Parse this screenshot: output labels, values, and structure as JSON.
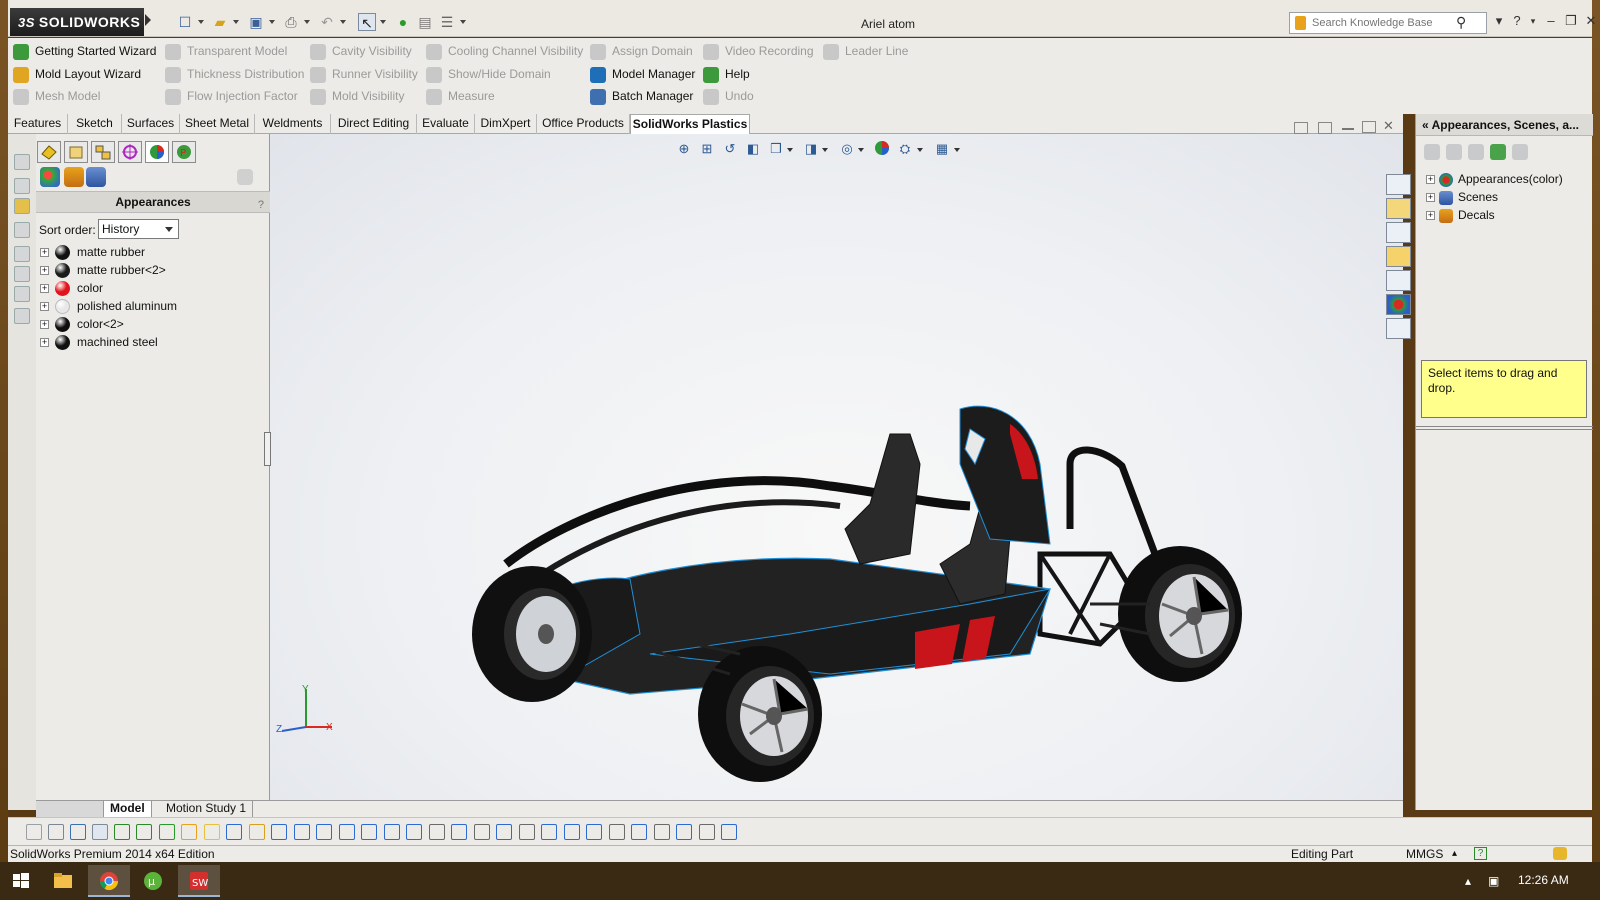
{
  "titlebar": {
    "logo_ds": "3S",
    "logo_text": "SOLIDWORKS",
    "document_title": "Ariel atom",
    "search_placeholder": "Search Knowledge Base",
    "search_icon": "magnifier-icon",
    "help_icon": "question-icon"
  },
  "command_manager": {
    "col1": [
      "Getting Started Wizard",
      "Mold Layout Wizard",
      "Mesh Model"
    ],
    "col2": [
      "Transparent Model",
      "Thickness Distribution",
      "Flow Injection Factor"
    ],
    "col3": [
      "Cavity Visibility",
      "Runner Visibility",
      "Mold Visibility"
    ],
    "col4": [
      "Cooling Channel Visibility",
      "Show/Hide Domain",
      "Measure"
    ],
    "col5": [
      "Assign Domain",
      "Model Manager",
      "Batch Manager"
    ],
    "col6": [
      "Video Recording",
      "Help",
      "Undo"
    ],
    "col7": [
      "Leader Line"
    ]
  },
  "tabs": [
    "Features",
    "Sketch",
    "Surfaces",
    "Sheet Metal",
    "Weldments",
    "Direct Editing",
    "Evaluate",
    "DimXpert",
    "Office Products",
    "SolidWorks Plastics"
  ],
  "active_tab": "SolidWorks Plastics",
  "feature_manager": {
    "header": "Appearances",
    "help": "?",
    "sort_label": "Sort order:",
    "sort_value": "History",
    "items": [
      {
        "label": "matte rubber",
        "color": "#111111"
      },
      {
        "label": "matte rubber<2>",
        "color": "#1a1a1a"
      },
      {
        "label": "color",
        "color": "#e0141b"
      },
      {
        "label": "polished aluminum",
        "color": "#e8e8e8"
      },
      {
        "label": "color<2>",
        "color": "#0d0d0d"
      },
      {
        "label": "machined steel",
        "color": "#101010"
      }
    ]
  },
  "bottom_tabs": [
    "Model",
    "Motion Study 1"
  ],
  "axes": {
    "x": "X",
    "y": "Y",
    "z": "Z"
  },
  "task_pane": {
    "title": "Appearances, Scenes, a...",
    "tree": [
      "Appearances(color)",
      "Scenes",
      "Decals"
    ],
    "hint": "Select items to drag and drop."
  },
  "statusbar": {
    "product": "SolidWorks Premium 2014 x64 Edition",
    "mode": "Editing Part",
    "units": "MMGS"
  },
  "taskbar": {
    "time": "12:26 AM",
    "apps": [
      "windows-start-icon",
      "file-explorer-icon",
      "chrome-icon",
      "utorrent-icon",
      "solidworks-icon"
    ]
  },
  "colors": {
    "accent_red": "#c8141b",
    "car_body": "#1c1c1c",
    "hint_bg": "#ffff8c",
    "edge_blue": "#1e90d8"
  }
}
